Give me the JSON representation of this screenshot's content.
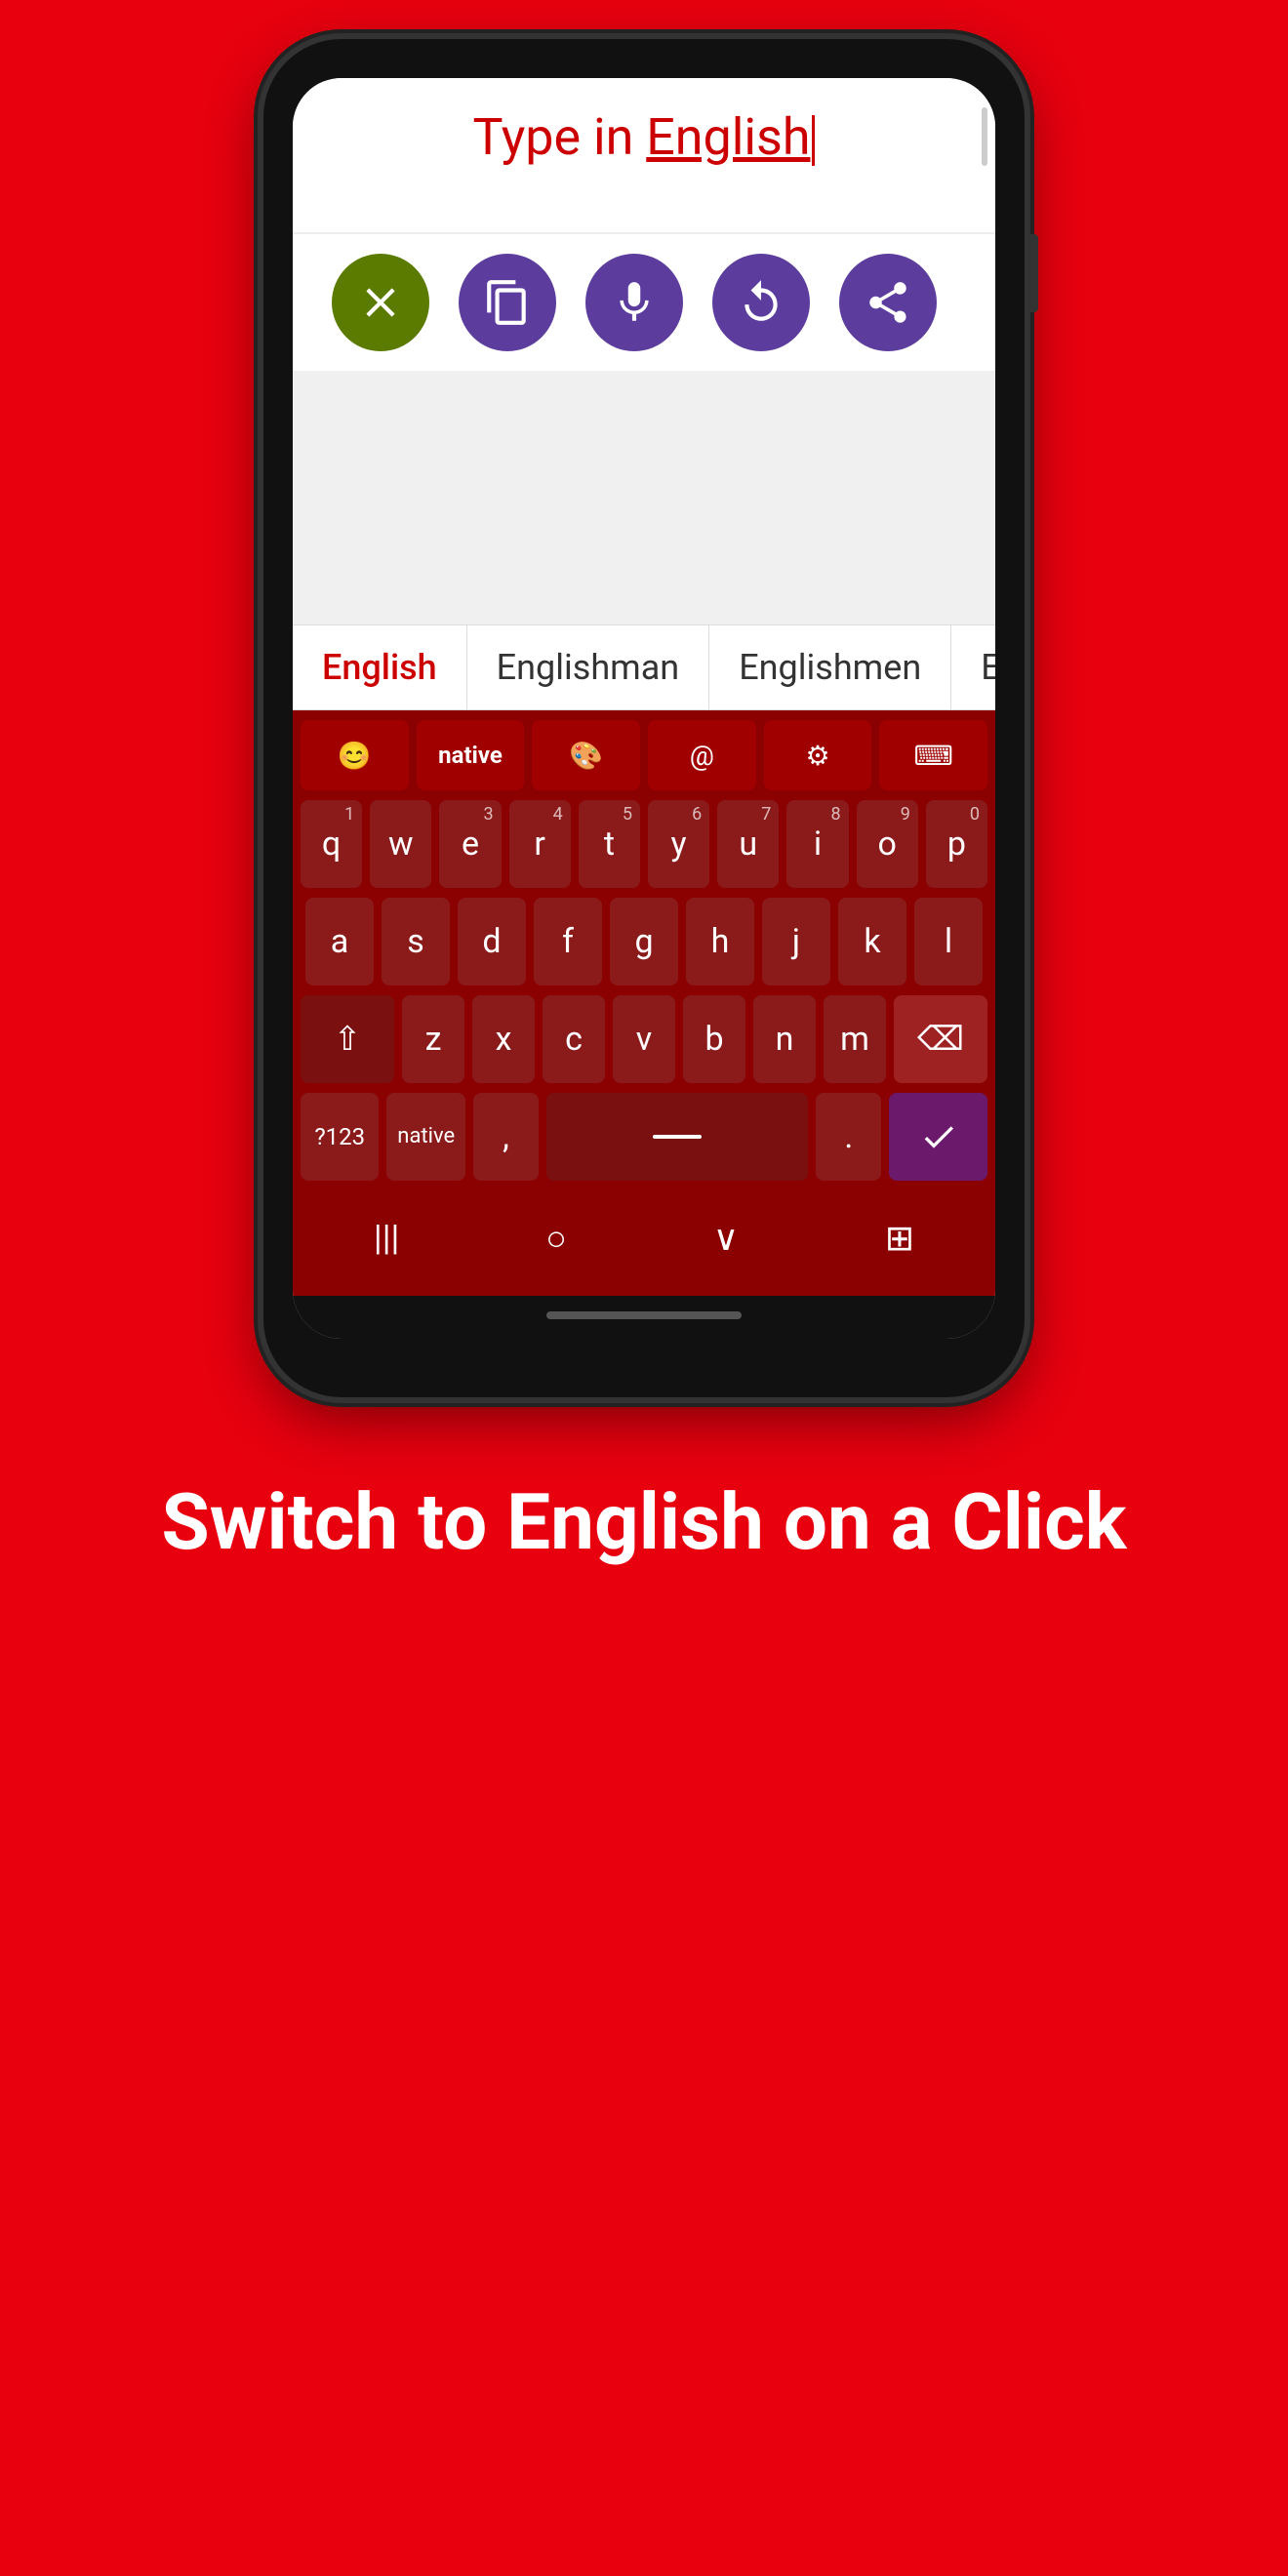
{
  "phone": {
    "text_area": {
      "typed_text_prefix": "Type in ",
      "typed_text_highlight": "English"
    },
    "action_buttons": [
      {
        "id": "delete",
        "label": "delete"
      },
      {
        "id": "copy",
        "label": "copy"
      },
      {
        "id": "mic",
        "label": "microphone"
      },
      {
        "id": "undo",
        "label": "undo"
      },
      {
        "id": "share",
        "label": "share"
      }
    ],
    "suggestions": [
      {
        "text": "English",
        "active": true
      },
      {
        "text": "Englishman",
        "active": false
      },
      {
        "text": "Englishmen",
        "active": false
      },
      {
        "text": "Eng",
        "active": false
      }
    ],
    "keyboard": {
      "top_row": [
        {
          "id": "emoji",
          "symbol": "😊"
        },
        {
          "id": "native",
          "label": "native"
        },
        {
          "id": "palette",
          "symbol": "🎨"
        },
        {
          "id": "at",
          "symbol": "@"
        },
        {
          "id": "settings",
          "symbol": "⚙"
        },
        {
          "id": "keyboard-hide",
          "symbol": "⌨"
        }
      ],
      "row1": [
        {
          "key": "q",
          "num": "1"
        },
        {
          "key": "w",
          "num": ""
        },
        {
          "key": "e",
          "num": "3"
        },
        {
          "key": "r",
          "num": "4"
        },
        {
          "key": "t",
          "num": "5"
        },
        {
          "key": "y",
          "num": "6"
        },
        {
          "key": "u",
          "num": "7"
        },
        {
          "key": "i",
          "num": "8"
        },
        {
          "key": "o",
          "num": "9"
        },
        {
          "key": "p",
          "num": "0"
        }
      ],
      "row2": [
        {
          "key": "a"
        },
        {
          "key": "s"
        },
        {
          "key": "d"
        },
        {
          "key": "f"
        },
        {
          "key": "g"
        },
        {
          "key": "h"
        },
        {
          "key": "j"
        },
        {
          "key": "k"
        },
        {
          "key": "l"
        }
      ],
      "row3_left": "⇧",
      "row3": [
        {
          "key": "z"
        },
        {
          "key": "x"
        },
        {
          "key": "c"
        },
        {
          "key": "v"
        },
        {
          "key": "b"
        },
        {
          "key": "n"
        },
        {
          "key": "m"
        }
      ],
      "row3_right": "⌫",
      "bottom_row": {
        "num_label": "?123",
        "native_label": "native",
        "comma": ",",
        "space": "",
        "period": ".",
        "done": "✓"
      },
      "nav": [
        "|||",
        "○",
        "∨",
        "⊞"
      ]
    }
  },
  "bottom_text": "Switch to English on a Click"
}
